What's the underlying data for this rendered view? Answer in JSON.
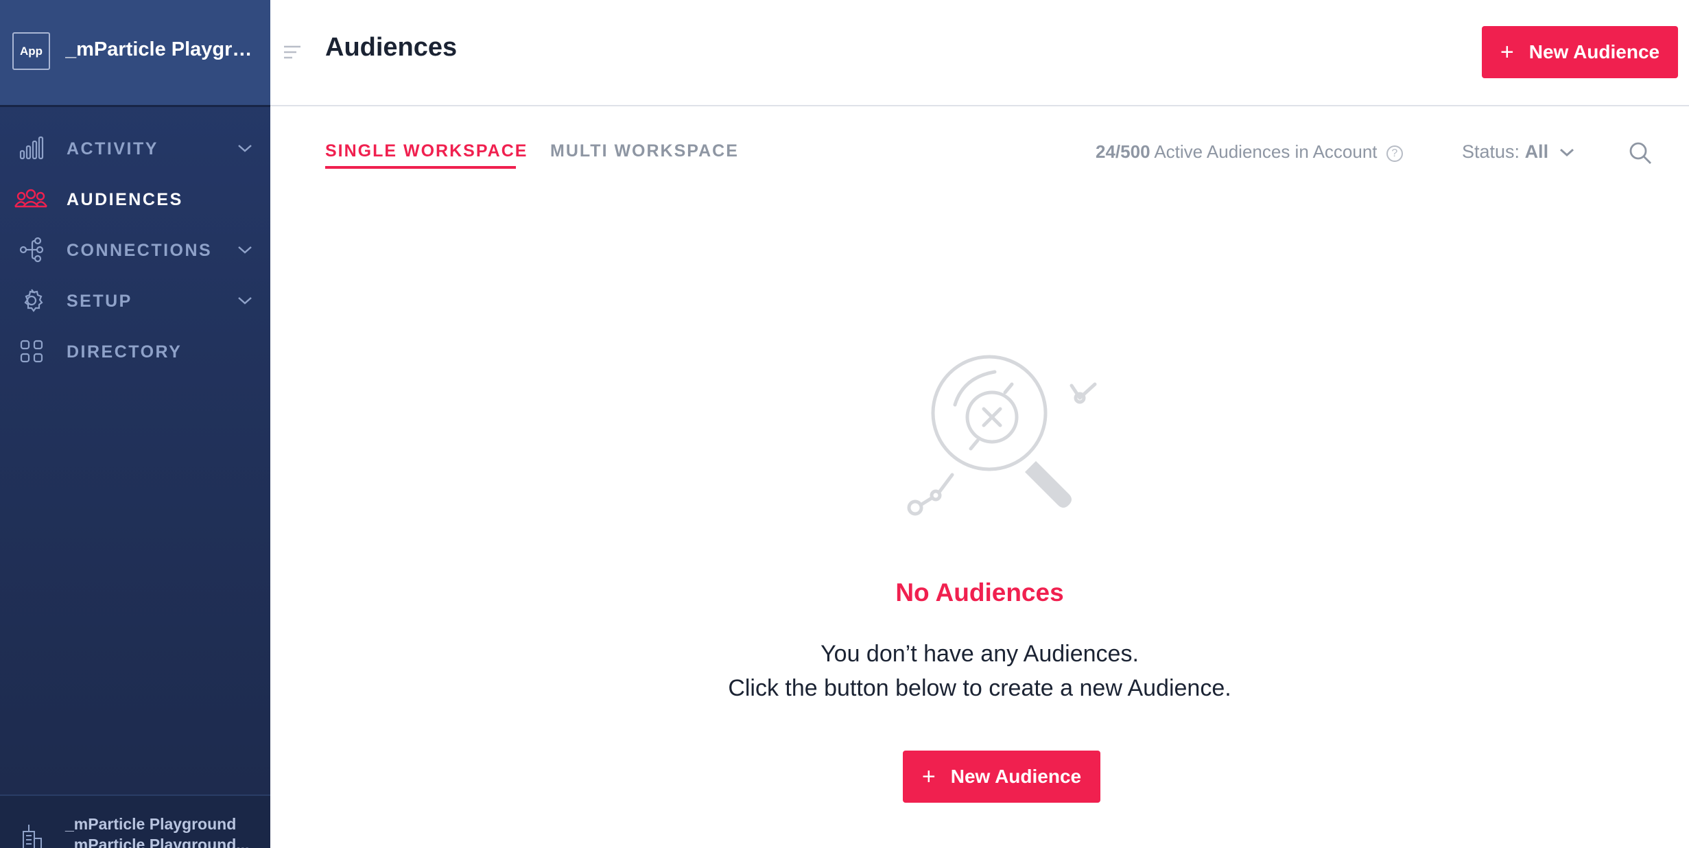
{
  "sidebar": {
    "app_badge": "App",
    "app_name": "_mParticle Playgro...",
    "items": [
      {
        "label": "ACTIVITY",
        "icon": "bar-chart-icon",
        "has_chevron": true,
        "active": false
      },
      {
        "label": "AUDIENCES",
        "icon": "users-icon",
        "has_chevron": false,
        "active": true
      },
      {
        "label": "CONNECTIONS",
        "icon": "connections-icon",
        "has_chevron": true,
        "active": false
      },
      {
        "label": "SETUP",
        "icon": "gear-icon",
        "has_chevron": true,
        "active": false
      },
      {
        "label": "DIRECTORY",
        "icon": "grid-icon",
        "has_chevron": false,
        "active": false
      }
    ],
    "account": {
      "name": "_mParticle Playground",
      "sub": "_mParticle Playground..."
    }
  },
  "header": {
    "title": "Audiences",
    "new_button": "New Audience"
  },
  "tabs": [
    {
      "label": "SINGLE WORKSPACE",
      "active": true
    },
    {
      "label": "MULTI WORKSPACE",
      "active": false
    }
  ],
  "toolbar": {
    "count_value": "24/500",
    "count_label": "Active Audiences in Account",
    "help": "?",
    "status_label": "Status:",
    "status_value": "All"
  },
  "empty_state": {
    "title": "No Audiences",
    "line1": "You don’t have any Audiences.",
    "line2": "Click the button below to create a new Audience.",
    "button": "New Audience"
  },
  "colors": {
    "accent": "#f0204f",
    "sidebar": "#22335d",
    "sidebar_header": "#324b7f",
    "muted_text": "#8e96a3"
  }
}
